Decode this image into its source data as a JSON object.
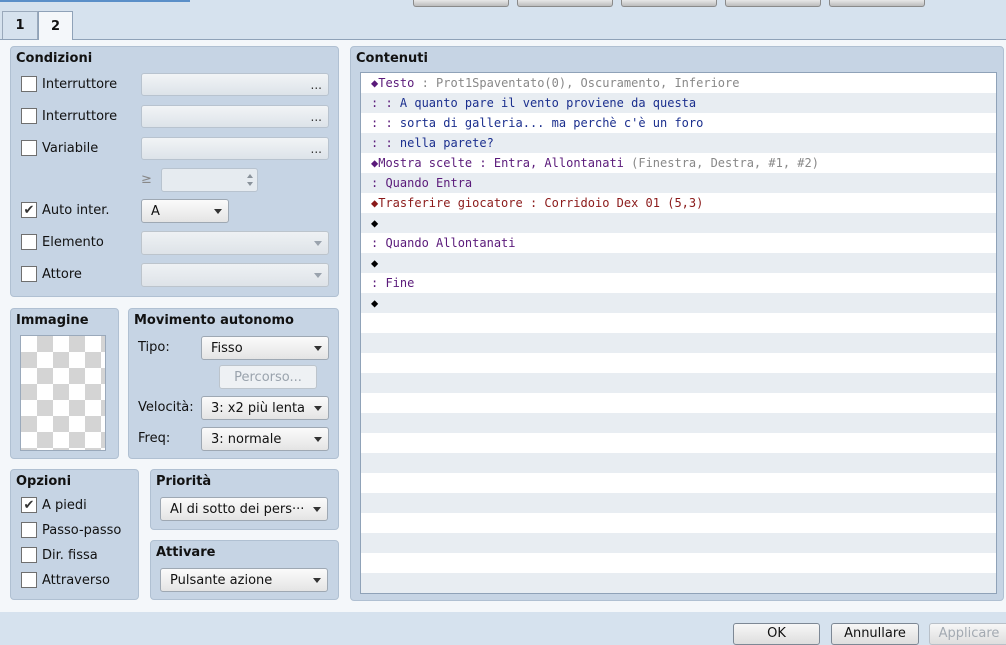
{
  "tabs": [
    {
      "label": "1"
    },
    {
      "label": "2"
    }
  ],
  "conditions": {
    "title": "Condizioni",
    "switch1": {
      "label": "Interruttore",
      "checked": false
    },
    "switch2": {
      "label": "Interruttore",
      "checked": false
    },
    "variable": {
      "label": "Variabile",
      "checked": false
    },
    "ge_symbol": "≥",
    "self_switch": {
      "label": "Auto inter.",
      "checked": true,
      "value": "A"
    },
    "item": {
      "label": "Elemento",
      "checked": false
    },
    "actor": {
      "label": "Attore",
      "checked": false
    },
    "ellipsis": "..."
  },
  "image": {
    "title": "Immagine"
  },
  "autonomous": {
    "title": "Movimento autonomo",
    "type_label": "Tipo:",
    "type_value": "Fisso",
    "route_button": "Percorso...",
    "speed_label": "Velocità:",
    "speed_value": "3: x2 più lenta",
    "freq_label": "Freq:",
    "freq_value": "3: normale"
  },
  "options": {
    "title": "Opzioni",
    "walking": {
      "label": "A piedi",
      "checked": true
    },
    "stepping": {
      "label": "Passo-passo",
      "checked": false
    },
    "direction_fix": {
      "label": "Dir. fissa",
      "checked": false
    },
    "through": {
      "label": "Attraverso",
      "checked": false
    }
  },
  "priority": {
    "title": "Priorità",
    "value": "Al di sotto dei pers···"
  },
  "trigger": {
    "title": "Attivare",
    "value": "Pulsante azione"
  },
  "contents": {
    "title": "Contenuti",
    "lines": [
      {
        "segments": [
          {
            "text": "◆Testo",
            "color": "#5a1a7a"
          },
          {
            "text": " : ",
            "color": "#888888"
          },
          {
            "text": "Prot1Spaventato(0), Oscuramento, Inferiore",
            "color": "#888888"
          }
        ]
      },
      {
        "segments": [
          {
            "text": ":        : ",
            "color": "#5a1a7a"
          },
          {
            "text": "A quanto pare il vento proviene da questa",
            "color": "#1b2f8e"
          }
        ]
      },
      {
        "segments": [
          {
            "text": ":        : ",
            "color": "#5a1a7a"
          },
          {
            "text": "sorta di galleria... ma perchè c'è un foro",
            "color": "#1b2f8e"
          }
        ]
      },
      {
        "segments": [
          {
            "text": ":        : ",
            "color": "#5a1a7a"
          },
          {
            "text": "nella parete?",
            "color": "#1b2f8e"
          }
        ]
      },
      {
        "segments": [
          {
            "text": "◆Mostra scelte",
            "color": "#5a1a7a"
          },
          {
            "text": " : ",
            "color": "#5a1a7a"
          },
          {
            "text": "Entra, Allontanati",
            "color": "#5a1a7a"
          },
          {
            "text": " (Finestra, Destra, #1, #2)",
            "color": "#888888"
          }
        ]
      },
      {
        "segments": [
          {
            "text": ": Quando Entra",
            "color": "#5a1a7a"
          }
        ]
      },
      {
        "segments": [
          {
            "text": "  ◆Trasferire giocatore",
            "color": "#8b1a1a"
          },
          {
            "text": " : ",
            "color": "#8b1a1a"
          },
          {
            "text": "Corridoio Dex 01 (5,3)",
            "color": "#8b1a1a"
          }
        ]
      },
      {
        "segments": [
          {
            "text": "  ◆",
            "color": "#000000"
          }
        ]
      },
      {
        "segments": [
          {
            "text": ": Quando Allontanati",
            "color": "#5a1a7a"
          }
        ]
      },
      {
        "segments": [
          {
            "text": "  ◆",
            "color": "#000000"
          }
        ]
      },
      {
        "segments": [
          {
            "text": ": Fine",
            "color": "#5a1a7a"
          }
        ]
      },
      {
        "segments": [
          {
            "text": "◆",
            "color": "#000000"
          }
        ]
      }
    ]
  },
  "footer": {
    "ok": "OK",
    "cancel": "Annullare",
    "apply": "Applicare"
  }
}
